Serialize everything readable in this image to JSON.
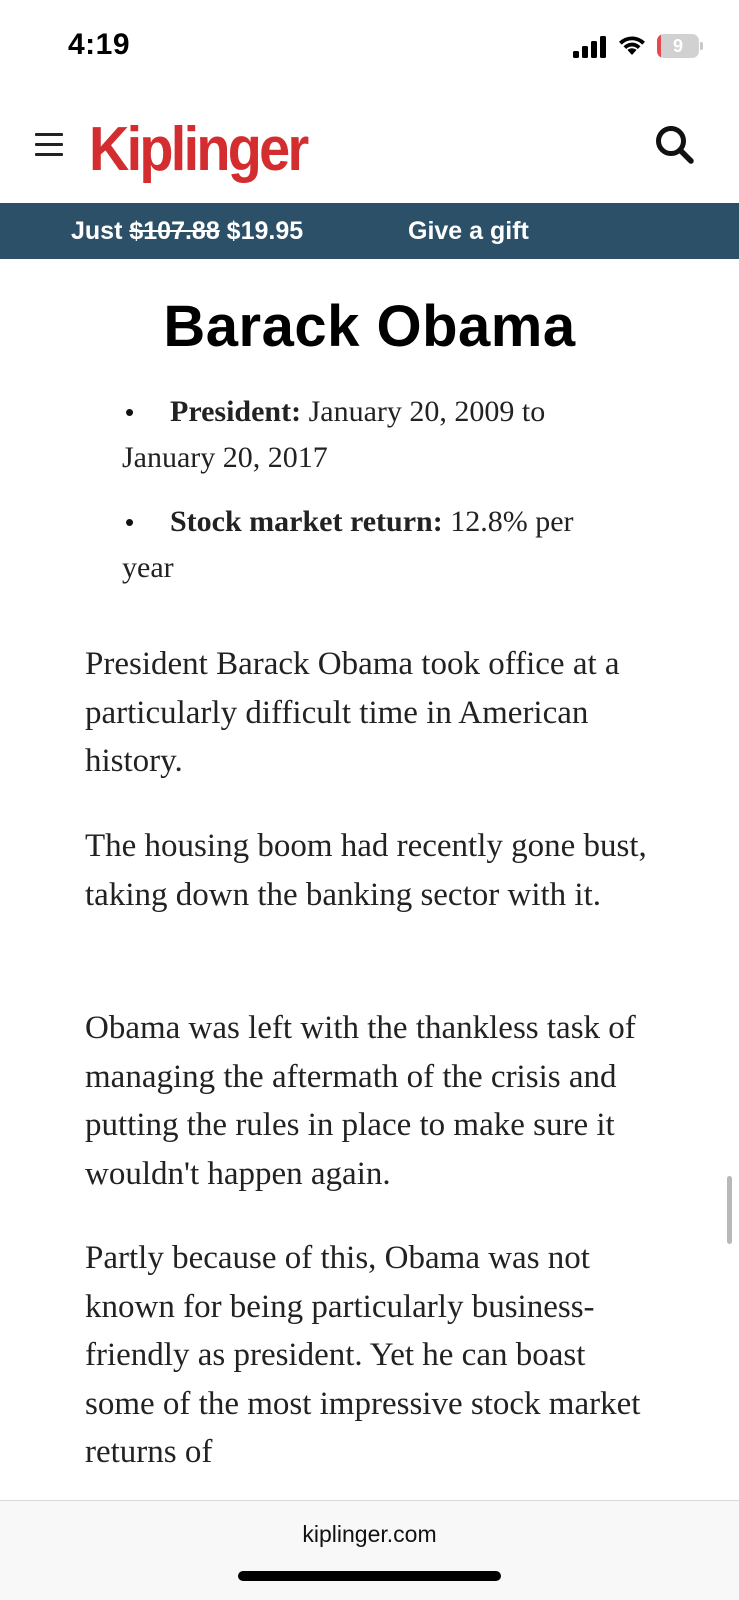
{
  "status_bar": {
    "time": "4:19",
    "battery_level": "9",
    "battery_fraction": 0.09
  },
  "header": {
    "logo_text": "Kiplinger",
    "brand_color": "#d32d2f"
  },
  "promo": {
    "prefix": "Just ",
    "old_price": "$107.88",
    "new_price": " $19.95",
    "gift_label": "Give a gift",
    "background_color": "#2b5067"
  },
  "article": {
    "heading": "Barack Obama",
    "bullets": [
      {
        "label": "President:",
        "text": " January 20, 2009 to January 20, 2017"
      },
      {
        "label": "Stock market return:",
        "text": " 12.8% per year"
      }
    ],
    "paragraphs": [
      "President Barack Obama took office at a particularly difficult time in American history.",
      "The housing boom had recently gone bust, taking down the banking sector with it.",
      "Obama was left with the thankless task of managing the aftermath of the crisis and putting the rules in place to make sure it wouldn't happen again.",
      "Partly because of this, Obama was not known for being particularly business-friendly as president. Yet he can boast some of the most impressive stock market returns of"
    ]
  },
  "bottom_bar": {
    "url": "kiplinger.com"
  }
}
